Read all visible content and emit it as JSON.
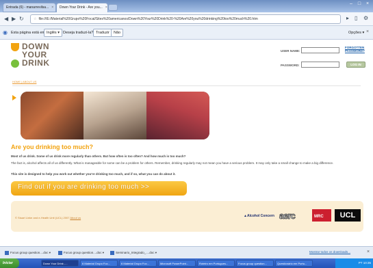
{
  "browser": {
    "tabs": [
      {
        "label": "Entrada (6) - manarrevilsa..."
      },
      {
        "label": "Down Your Drink - Are you..."
      }
    ],
    "url": "file:///E:/Material%20Grupo%20Focal/Sites%20americanos/Down%20Your%20Drink%20-%20Are%20you%20drinking%20too%20much%20.htm",
    "menu_label": "Opções"
  },
  "translate_bar": {
    "prefix": "Esta página está em",
    "language": "Inglês",
    "question": "Deseja traduzi-la?",
    "translate_button": "Traduzir",
    "no_button": "Não"
  },
  "site": {
    "logo": {
      "line1": "DOWN",
      "line2": "YOUR",
      "line3": "DRINK"
    },
    "login": {
      "username_label": "USER NAME:",
      "password_label": "PASSWORD:",
      "forgotten_link": "FORGOTTEN PASSWORD?",
      "login_button": "LOG IN"
    },
    "nav": "HOME | ABOUT US",
    "heading": "Are you drinking too much?",
    "para1": "Most of us drink. Some of us drink more regularly than others. But how often is too often? And how much is too much?",
    "para2": "The fact is, alcohol affects all of us differently. What is manageable for some can be a problem for others. Remember, drinking regularly may not mean you have a serious problem. It may only take a small change to make a big difference.",
    "para3": "This site is designed to help you work out whether you're drinking too much, and if so, what you can do about it.",
    "cta_button": "Find out if you are drinking too much >>",
    "footer": {
      "copyright": "© Stuart Linke and e-Health Unit (UCL) 2007",
      "about_link": "About us",
      "logos": [
        "Alcohol Concern",
        "aerc",
        "MRC",
        "UCL"
      ]
    }
  },
  "downloads": {
    "items": [
      "Focus group question....doc",
      "Focus group question....doc",
      "Seminario_Integrado_....doc"
    ],
    "show_all": "Mostrar todos os downloads..."
  },
  "taskbar": {
    "start": "Iniciar",
    "tasks": [
      "Down Your Drink -...",
      "6 Material Grupo Foc...",
      "6 Material Grupo Foc...",
      "Microsoft PowerPoint...",
      "Roteiro em Portugues...",
      "Focus group question...",
      "Questionário em Portu..."
    ],
    "tray_lang": "PT",
    "clock": "10:35"
  }
}
